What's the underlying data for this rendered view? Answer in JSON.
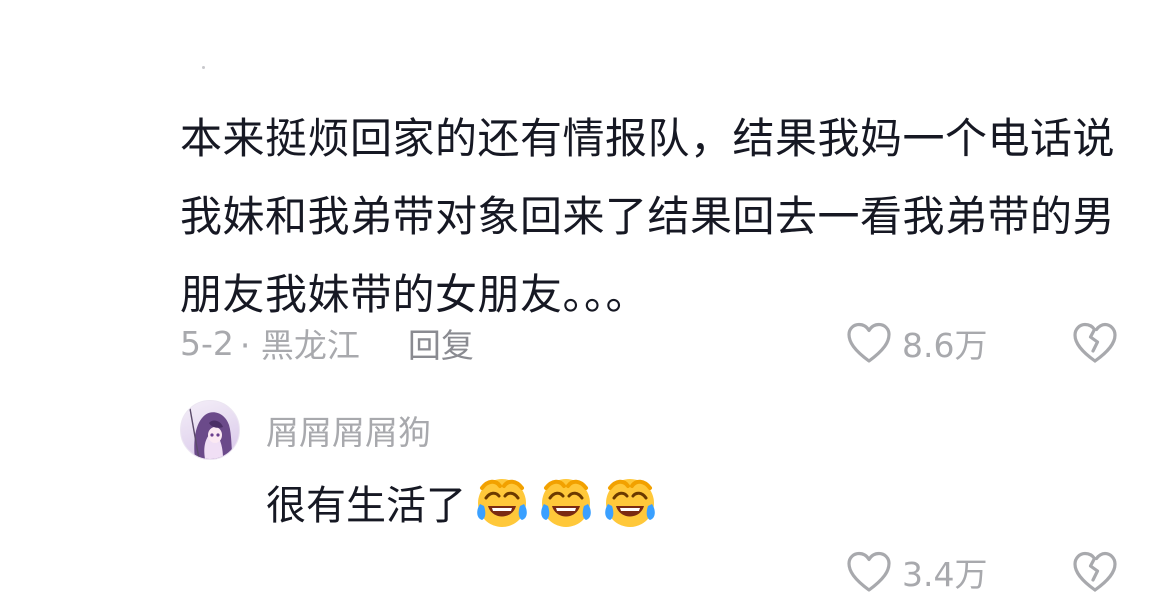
{
  "comment": {
    "text": "本来挺烦回家的还有情报队，结果我妈一个电话说我妹和我弟带对象回来了结果回去一看我弟带的男朋友我妹带的女朋友。。。",
    "date": "5-2",
    "location": "· 黑龙江",
    "reply_label": "回复",
    "likes": "8.6万"
  },
  "reply": {
    "username": "屑屑屑屑狗",
    "text": "很有生活了",
    "emoji_icon": "laughing-crying-emoji",
    "emoji_count": 3,
    "likes": "3.4万"
  },
  "icons": {
    "like": "heart-outline-icon",
    "dislike": "broken-heart-icon"
  },
  "colors": {
    "text_primary": "#161823",
    "text_secondary": "#a8a9ad",
    "emoji_yellow": "#ffc83a",
    "emoji_blue": "#3aa0ff"
  }
}
